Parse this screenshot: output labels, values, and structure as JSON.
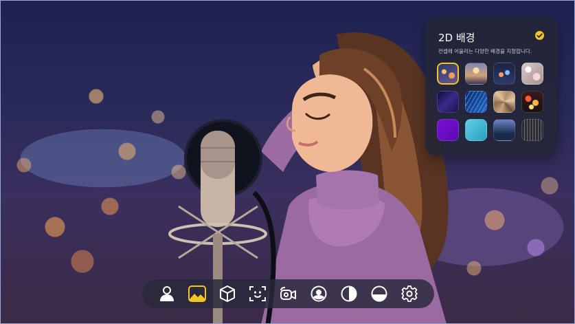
{
  "panel": {
    "title": "2D 배경",
    "subtitle": "컨셉에 어울리는 다양한 배경을 지정합니다.",
    "selected_index": 0,
    "backgrounds": [
      {
        "name": "city-night-bokeh"
      },
      {
        "name": "sunset-sky"
      },
      {
        "name": "night-city-lights"
      },
      {
        "name": "light-bokeh"
      },
      {
        "name": "purple-neon-lines"
      },
      {
        "name": "blue-light-streaks"
      },
      {
        "name": "gold-geometric"
      },
      {
        "name": "red-orange-bokeh"
      },
      {
        "name": "solid-purple"
      },
      {
        "name": "solid-cyan"
      },
      {
        "name": "blue-gradient"
      },
      {
        "name": "dark-curtain"
      }
    ]
  },
  "toolbar": {
    "tools": [
      {
        "name": "avatar-icon"
      },
      {
        "name": "background-image-icon",
        "active": true
      },
      {
        "name": "3d-cube-icon"
      },
      {
        "name": "face-tracking-icon"
      },
      {
        "name": "camera-icon"
      },
      {
        "name": "filter-icon"
      },
      {
        "name": "contrast-icon"
      },
      {
        "name": "brightness-icon"
      },
      {
        "name": "settings-gear-icon"
      }
    ]
  },
  "colors": {
    "accent": "#f3c623",
    "panel_bg": "#232638",
    "toolbar_bg": "#28283a",
    "icon": "#ffffff"
  }
}
